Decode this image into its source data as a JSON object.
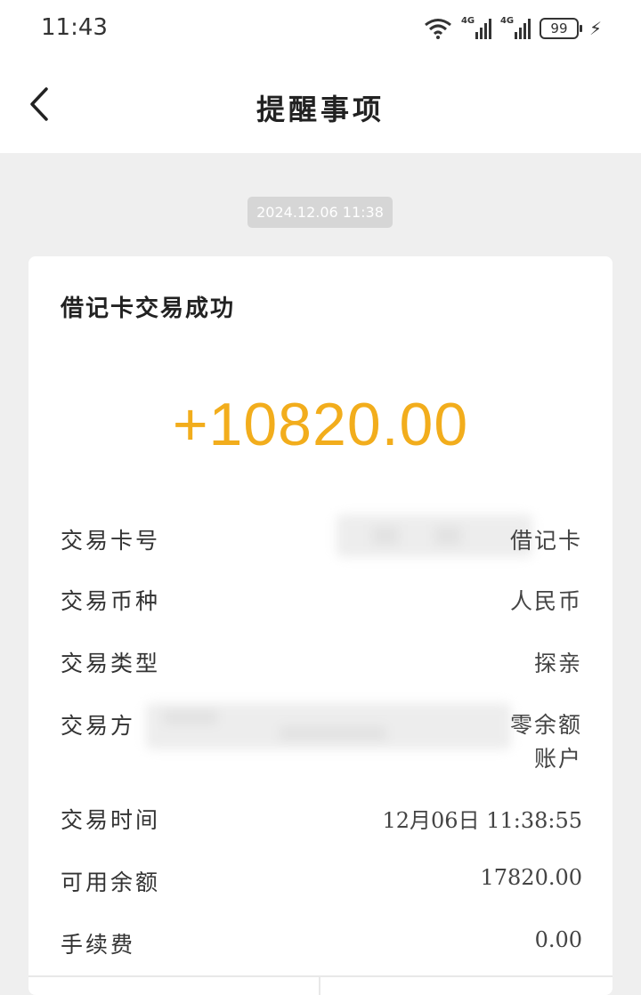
{
  "status_bar": {
    "time": "11:43",
    "battery": "99",
    "network_labels": [
      "4G",
      "4G"
    ]
  },
  "header": {
    "title": "提醒事项"
  },
  "message": {
    "timestamp": "2024.12.06  11:38",
    "title": "借记卡交易成功",
    "amount": "+10820.00",
    "amount_color": "#f2ad1c",
    "rows": [
      {
        "label": "交易卡号",
        "value": "借记卡"
      },
      {
        "label": "交易币种",
        "value": "人民币"
      },
      {
        "label": "交易类型",
        "value": "探亲"
      },
      {
        "label": "交易方",
        "value_line1": "零余额",
        "value_line2": "账户"
      },
      {
        "label": "交易时间",
        "value": "12月06日  11:38:55"
      },
      {
        "label": "可用余额",
        "value": "17820.00"
      },
      {
        "label": "手续费",
        "value": "0.00"
      }
    ]
  }
}
